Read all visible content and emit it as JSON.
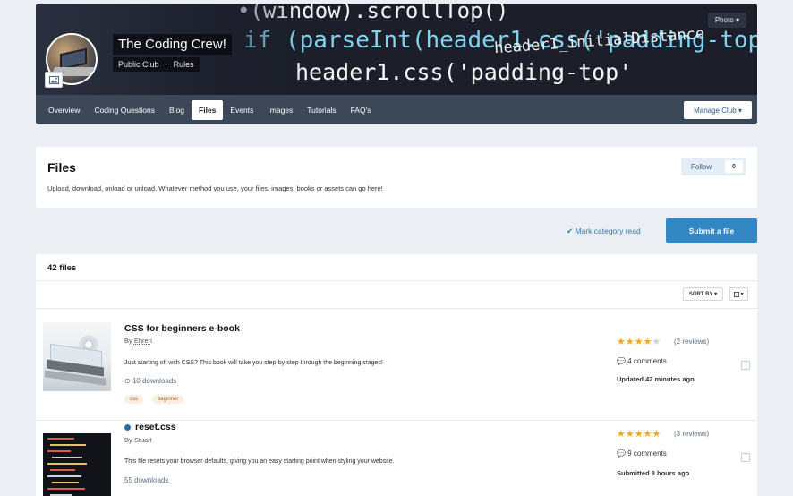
{
  "club": {
    "name": "The Coding Crew!",
    "type": "Public Club",
    "meta_separator": "·",
    "rules_link": "Rules",
    "photo_button": "Photo",
    "manage_button": "Manage Club",
    "cover_code": [
      "•(window).scrollTop()",
      "if (parseInt(header1.css('padding-top'),",
      "header1_initialDistance",
      "header1.css('padding-top'"
    ]
  },
  "nav": {
    "items": [
      {
        "label": "Overview"
      },
      {
        "label": "Coding Questions"
      },
      {
        "label": "Blog"
      },
      {
        "label": "Files",
        "active": true
      },
      {
        "label": "Events"
      },
      {
        "label": "Images"
      },
      {
        "label": "Tutorials"
      },
      {
        "label": "FAQ's"
      }
    ]
  },
  "category": {
    "title": "Files",
    "description": "Upload, download, onload or unload. Whatever method you use, your files, images, books or assets can go here!",
    "follow_label": "Follow",
    "follow_count": "0"
  },
  "actions": {
    "mark_read": "Mark category read",
    "submit": "Submit a file"
  },
  "list": {
    "count_label": "42 files",
    "sort_label": "SORT BY",
    "files": [
      {
        "title": "CSS for beginners e-book",
        "by_prefix": "By",
        "author": "Ehren",
        "description": "Just starting off with CSS? This book will take you step-by-step through the beginning stages!",
        "downloads": "10 downloads",
        "tags": [
          "css",
          "beginner"
        ],
        "rating": 4,
        "reviews": "(2 reviews)",
        "comments": "4 comments",
        "updated": "Updated 42 minutes ago"
      },
      {
        "title": "reset.css",
        "by_prefix": "By",
        "author": "Stuart",
        "description": "This file resets your browser defaults, giving you an easy starting point when styling your website.",
        "downloads": "55 downloads",
        "rating": 5,
        "reviews": "(3 reviews)",
        "comments": "9 comments",
        "updated": "Submitted 3 hours ago"
      }
    ]
  },
  "colors": {
    "accent": "#3186c4",
    "nav_bg": "#3c4757",
    "star": "#f5a623"
  }
}
